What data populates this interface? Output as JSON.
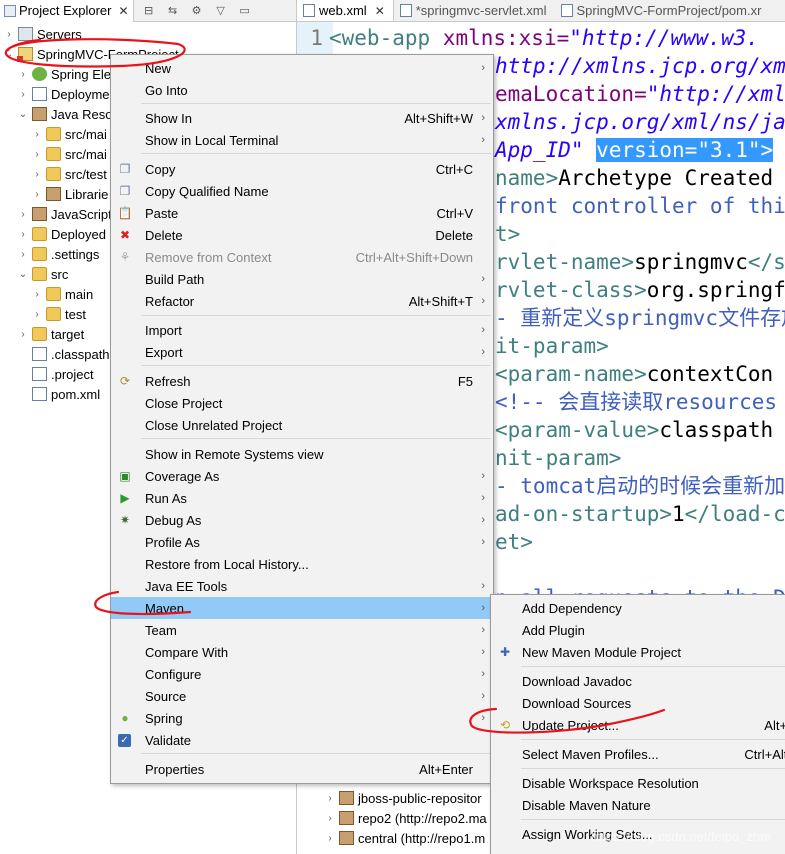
{
  "explorer": {
    "title": "Project Explorer",
    "tree": [
      {
        "label": "Servers",
        "icon": "server-icon"
      },
      {
        "label": "SpringMVC-FormProject",
        "icon": "project-icon"
      },
      {
        "label": "Spring Ele",
        "icon": "spring-icon"
      },
      {
        "label": "Deployme",
        "icon": "deploy-icon"
      },
      {
        "label": "Java Reso",
        "icon": "java-resources-icon"
      },
      {
        "label": "src/mai",
        "icon": "package-folder-icon"
      },
      {
        "label": "src/mai",
        "icon": "package-folder-icon"
      },
      {
        "label": "src/test",
        "icon": "package-folder-icon"
      },
      {
        "label": "Librarie",
        "icon": "library-icon"
      },
      {
        "label": "JavaScript",
        "icon": "javascript-icon"
      },
      {
        "label": "Deployed",
        "icon": "deployed-icon"
      },
      {
        "label": ".settings",
        "icon": "folder-icon"
      },
      {
        "label": "src",
        "icon": "folder-icon"
      },
      {
        "label": "main",
        "icon": "folder-icon"
      },
      {
        "label": "test",
        "icon": "folder-icon"
      },
      {
        "label": "target",
        "icon": "folder-icon"
      },
      {
        "label": ".classpath",
        "icon": "file-icon"
      },
      {
        "label": ".project",
        "icon": "file-icon"
      },
      {
        "label": "pom.xml",
        "icon": "maven-file-icon"
      }
    ]
  },
  "editor": {
    "tabs": [
      {
        "label": "web.xml",
        "active": true
      },
      {
        "label": "*springmvc-servlet.xml",
        "active": false
      },
      {
        "label": "SpringMVC-FormProject/pom.xr",
        "active": false
      }
    ],
    "lines": {
      "l1_num": "1",
      "l1_tag": "<web-app",
      "l1_attr": " xmlns:xsi=",
      "l1_val": "\"http://www.w3.",
      "l2_val": "http://xmlns.jcp.org/xm",
      "l3_attr": "emaLocation=",
      "l3_val": "\"http://xmlr",
      "l4_val": "xmlns.jcp.org/xml/ns/ja",
      "l5_val": "App_ID\"",
      "l5_sel": "version=\"3.1\">",
      "l6_tag": "name>",
      "l6_txt": "Archetype Created",
      "l7_cm": "front controller of thi",
      "l8_tag": "t>",
      "l9_tag": "rvlet-name>",
      "l9_txt": "springmvc",
      "l9_tag2": "</s",
      "l10_tag": "rvlet-class>",
      "l10_txt": "org.springf",
      "l11_cm": "- 重新定义springmvc文件存放",
      "l12_tag": "it-param>",
      "l13_tag": " <param-name>",
      "l13_txt": "contextCon",
      "l14_cm": " <!-- 会直接读取resources",
      "l15_tag": " <param-value>",
      "l15_txt": "classpath",
      "l16_tag": "nit-param>",
      "l17_cm": "- tomcat启动的时候会重新加载",
      "l18_tag": "ad-on-startup>",
      "l18_txt": "1",
      "l18_tag2": "</load-c",
      "l19_tag": "et>",
      "l21_cm": "p all requests to the D"
    },
    "bottom_rows": [
      "jboss-public-repositor",
      "repo2 (http://repo2.ma",
      "central (http://repo1.m"
    ]
  },
  "context_menu": {
    "items": [
      {
        "label": "New",
        "shortcut": "",
        "submenu": true
      },
      {
        "label": "Go Into",
        "shortcut": "",
        "submenu": false
      },
      {
        "label": "Show In",
        "shortcut": "Alt+Shift+W",
        "submenu": true
      },
      {
        "label": "Show in Local Terminal",
        "shortcut": "",
        "submenu": true
      },
      {
        "label": "Copy",
        "shortcut": "Ctrl+C",
        "icon": "copy-icon"
      },
      {
        "label": "Copy Qualified Name",
        "shortcut": "",
        "icon": "copy-qualified-icon"
      },
      {
        "label": "Paste",
        "shortcut": "Ctrl+V",
        "icon": "paste-icon"
      },
      {
        "label": "Delete",
        "shortcut": "Delete",
        "icon": "delete-icon"
      },
      {
        "label": "Remove from Context",
        "shortcut": "Ctrl+Alt+Shift+Down",
        "disabled": true,
        "icon": "remove-context-icon"
      },
      {
        "label": "Build Path",
        "shortcut": "",
        "submenu": true
      },
      {
        "label": "Refactor",
        "shortcut": "Alt+Shift+T",
        "submenu": true
      },
      {
        "label": "Import",
        "shortcut": "",
        "submenu": true
      },
      {
        "label": "Export",
        "shortcut": "",
        "submenu": true
      },
      {
        "label": "Refresh",
        "shortcut": "F5",
        "icon": "refresh-icon"
      },
      {
        "label": "Close Project",
        "shortcut": ""
      },
      {
        "label": "Close Unrelated Project",
        "shortcut": ""
      },
      {
        "label": "Show in Remote Systems view",
        "shortcut": ""
      },
      {
        "label": "Coverage As",
        "shortcut": "",
        "submenu": true,
        "icon": "coverage-icon"
      },
      {
        "label": "Run As",
        "shortcut": "",
        "submenu": true,
        "icon": "run-icon"
      },
      {
        "label": "Debug As",
        "shortcut": "",
        "submenu": true,
        "icon": "debug-icon"
      },
      {
        "label": "Profile As",
        "shortcut": "",
        "submenu": true
      },
      {
        "label": "Restore from Local History...",
        "shortcut": ""
      },
      {
        "label": "Java EE Tools",
        "shortcut": "",
        "submenu": true
      },
      {
        "label": "Maven",
        "shortcut": "",
        "submenu": true,
        "highlighted": true
      },
      {
        "label": "Team",
        "shortcut": "",
        "submenu": true
      },
      {
        "label": "Compare With",
        "shortcut": "",
        "submenu": true
      },
      {
        "label": "Configure",
        "shortcut": "",
        "submenu": true
      },
      {
        "label": "Source",
        "shortcut": "",
        "submenu": true
      },
      {
        "label": "Spring",
        "shortcut": "",
        "submenu": true,
        "icon": "spring-icon"
      },
      {
        "label": "Validate",
        "shortcut": "",
        "icon": "validate-checkbox-icon"
      },
      {
        "label": "Properties",
        "shortcut": "Alt+Enter"
      }
    ]
  },
  "maven_submenu": {
    "items": [
      {
        "label": "Add Dependency",
        "shortcut": ""
      },
      {
        "label": "Add Plugin",
        "shortcut": ""
      },
      {
        "label": "New Maven Module Project",
        "shortcut": "",
        "icon": "maven-module-icon"
      },
      {
        "label": "Download Javadoc",
        "shortcut": ""
      },
      {
        "label": "Download Sources",
        "shortcut": ""
      },
      {
        "label": "Update Project...",
        "shortcut": "Alt+F",
        "icon": "update-project-icon"
      },
      {
        "label": "Select Maven Profiles...",
        "shortcut": "Ctrl+Alt+"
      },
      {
        "label": "Disable Workspace Resolution",
        "shortcut": ""
      },
      {
        "label": "Disable Maven Nature",
        "shortcut": ""
      },
      {
        "label": "Assign Working Sets...",
        "shortcut": ""
      }
    ]
  },
  "watermark": "https://blog.csdn.net/feipo_zhm",
  "colors": {
    "menu_bg": "#f2f2f2",
    "menu_highlight": "#91c9f7",
    "annotation_red": "#e8141b",
    "selection_blue": "#3399ff"
  }
}
